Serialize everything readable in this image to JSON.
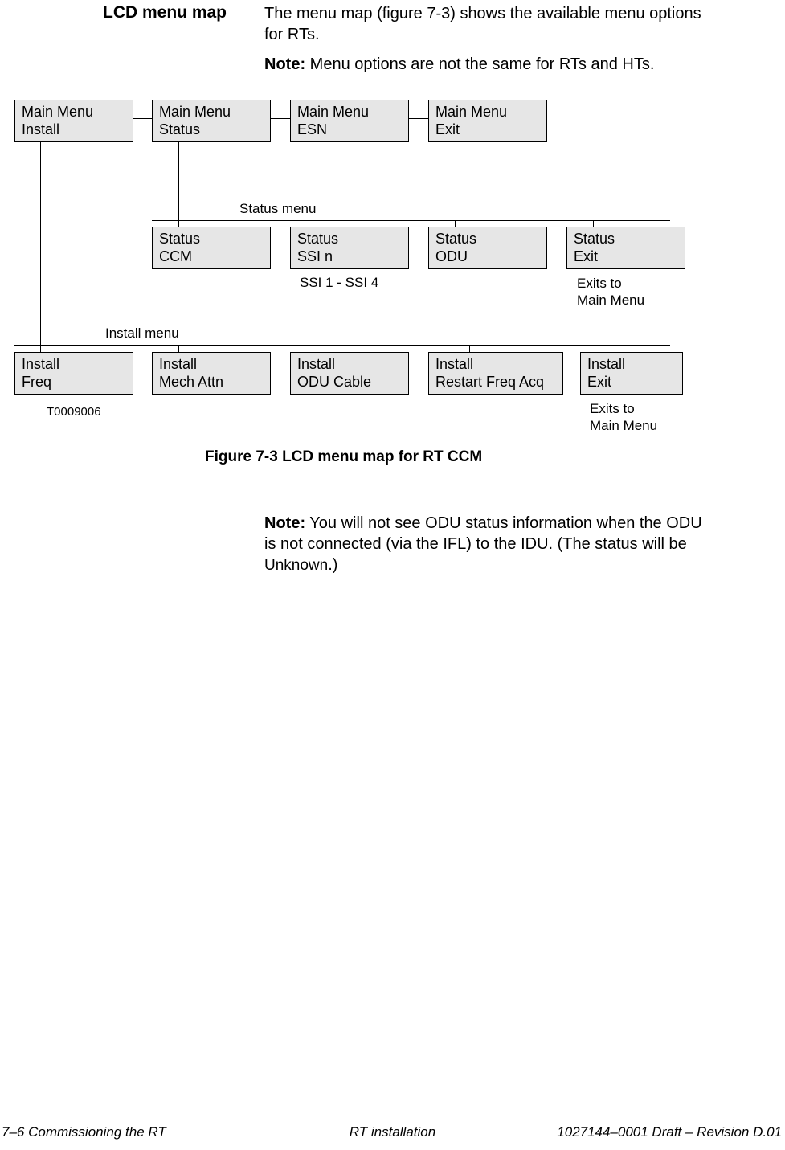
{
  "header": {
    "section_title": "LCD menu map",
    "intro_text": "The menu map (figure 7-3) shows the available menu options for RTs.",
    "note1_label": "Note:",
    "note1_text": " Menu options are not the same for RTs and HTs."
  },
  "diagram": {
    "main_row": [
      {
        "l1": "Main Menu",
        "l2": "Install"
      },
      {
        "l1": "Main Menu",
        "l2": "Status"
      },
      {
        "l1": "Main Menu",
        "l2": "ESN"
      },
      {
        "l1": "Main Menu",
        "l2": "Exit"
      }
    ],
    "status_label": "Status menu",
    "status_row": [
      {
        "l1": "Status",
        "l2": "CCM"
      },
      {
        "l1": "Status",
        "l2": "SSI n"
      },
      {
        "l1": "Status",
        "l2": "ODU"
      },
      {
        "l1": "Status",
        "l2": "Exit"
      }
    ],
    "ssi_note": "SSI 1 - SSI 4",
    "status_exit_note": "Exits to\nMain Menu",
    "install_label": "Install menu",
    "install_row": [
      {
        "l1": "Install",
        "l2": "Freq"
      },
      {
        "l1": "Install",
        "l2": "Mech Attn"
      },
      {
        "l1": "Install",
        "l2": "ODU Cable"
      },
      {
        "l1": "Install",
        "l2": "Restart Freq Acq"
      },
      {
        "l1": "Install",
        "l2": "Exit"
      }
    ],
    "install_exit_note": "Exits to\nMain Menu",
    "figure_id": "T0009006",
    "caption": "Figure  7-3   LCD menu map for RT CCM"
  },
  "note2": {
    "label": "Note:",
    "text_part1": " You will not see ODU status information when the ODU is not connected (via the IFL) to the IDU. (The status will be ",
    "unknown": "Unknown",
    "text_part2": ".)"
  },
  "footer": {
    "left": "7–6  Commissioning the RT",
    "center": "RT installation",
    "right": "1027144–0001   Draft – Revision D.01"
  }
}
